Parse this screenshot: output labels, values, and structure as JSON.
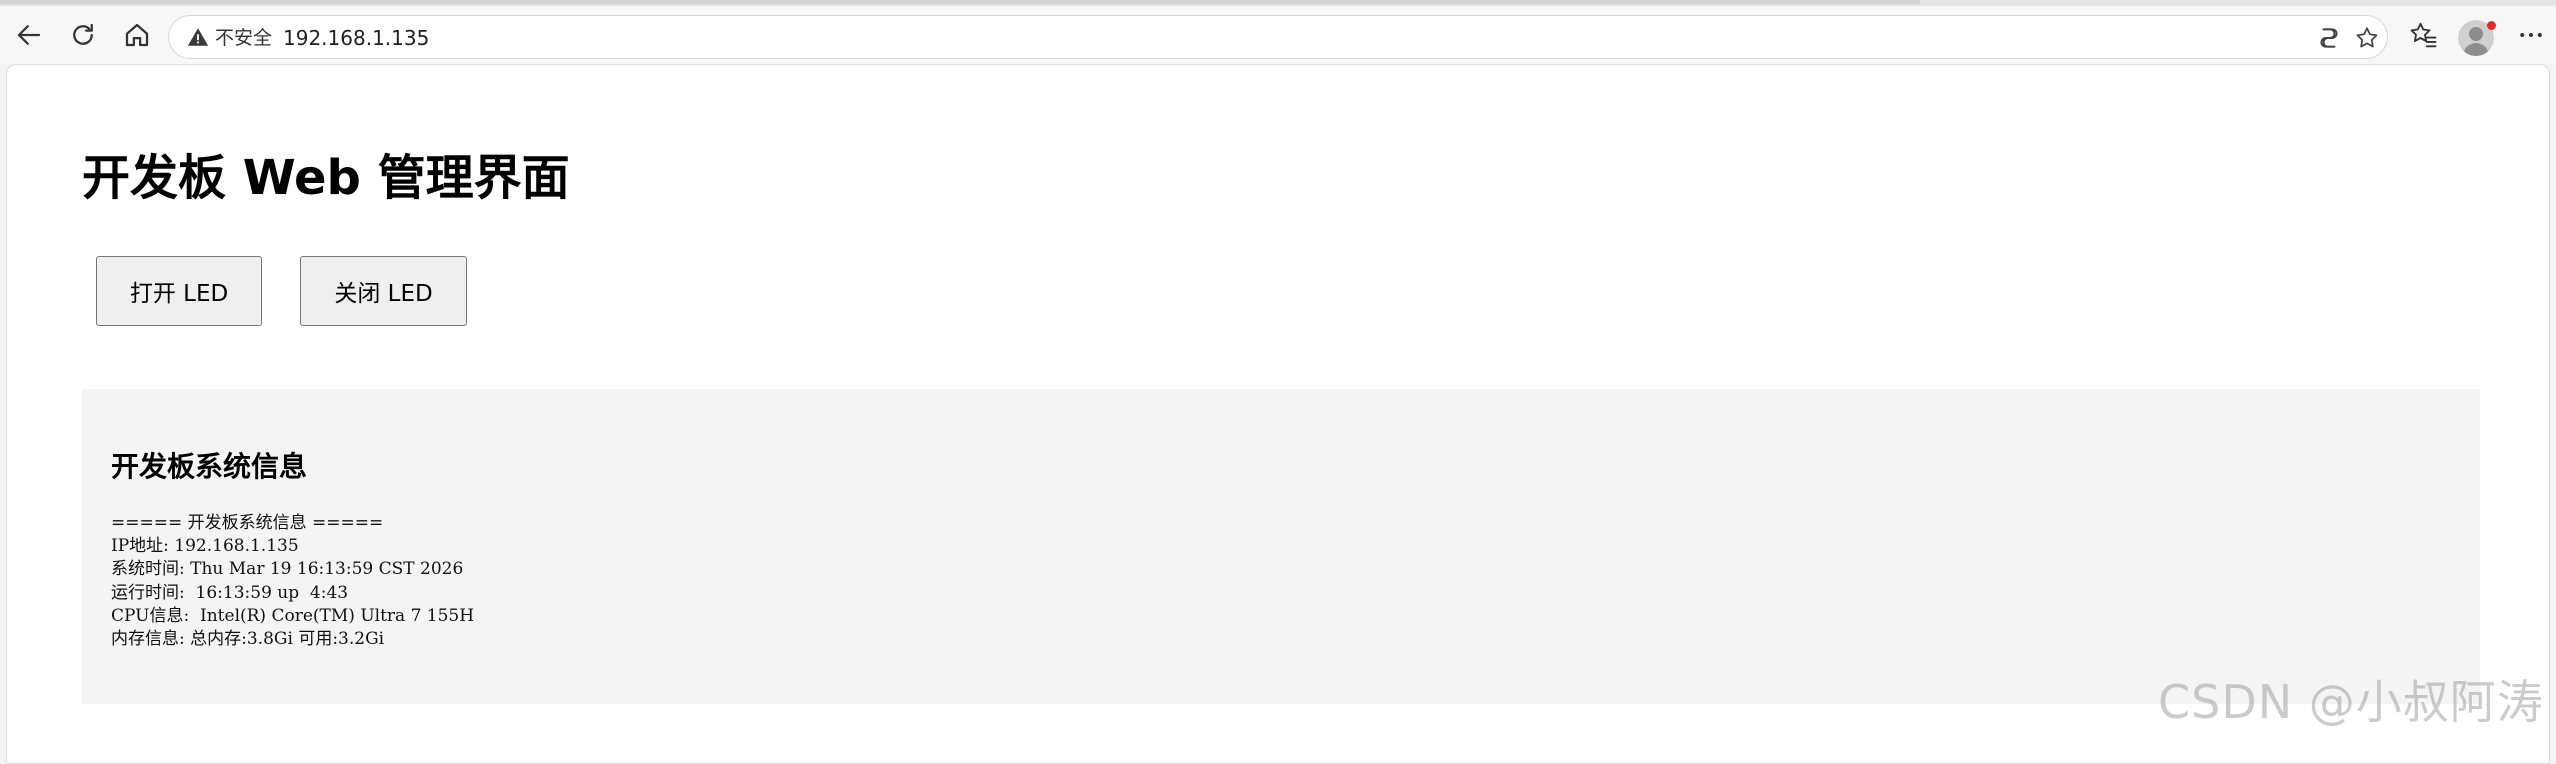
{
  "browser": {
    "security_label": "不安全",
    "url": "192.168.1.135",
    "icons": {
      "back": "arrow-left-icon",
      "reload": "reload-icon",
      "home": "home-icon",
      "warning": "warning-icon",
      "copilot": "copilot-icon",
      "favorite": "star-icon",
      "favorites": "favorites-icon",
      "profile": "avatar",
      "menu": "more-icon"
    }
  },
  "page": {
    "title": "开发板 Web 管理界面",
    "buttons": {
      "on": "打开 LED",
      "off": "关闭 LED"
    },
    "info": {
      "heading": "开发板系统信息",
      "lines": [
        "===== 开发板系统信息 =====",
        "IP地址: 192.168.1.135",
        "系统时间: Thu Mar 19 16:13:59 CST 2026",
        "运行时间:  16:13:59 up  4:43",
        "CPU信息:  Intel(R) Core(TM) Ultra 7 155H",
        "内存信息: 总内存:3.8Gi 可用:3.2Gi"
      ]
    }
  },
  "watermark": "CSDN @小叔阿涛",
  "colors": {
    "panel_bg": "#f4f4f4",
    "button_bg": "#efefef",
    "notification_dot": "#e32a2a"
  }
}
